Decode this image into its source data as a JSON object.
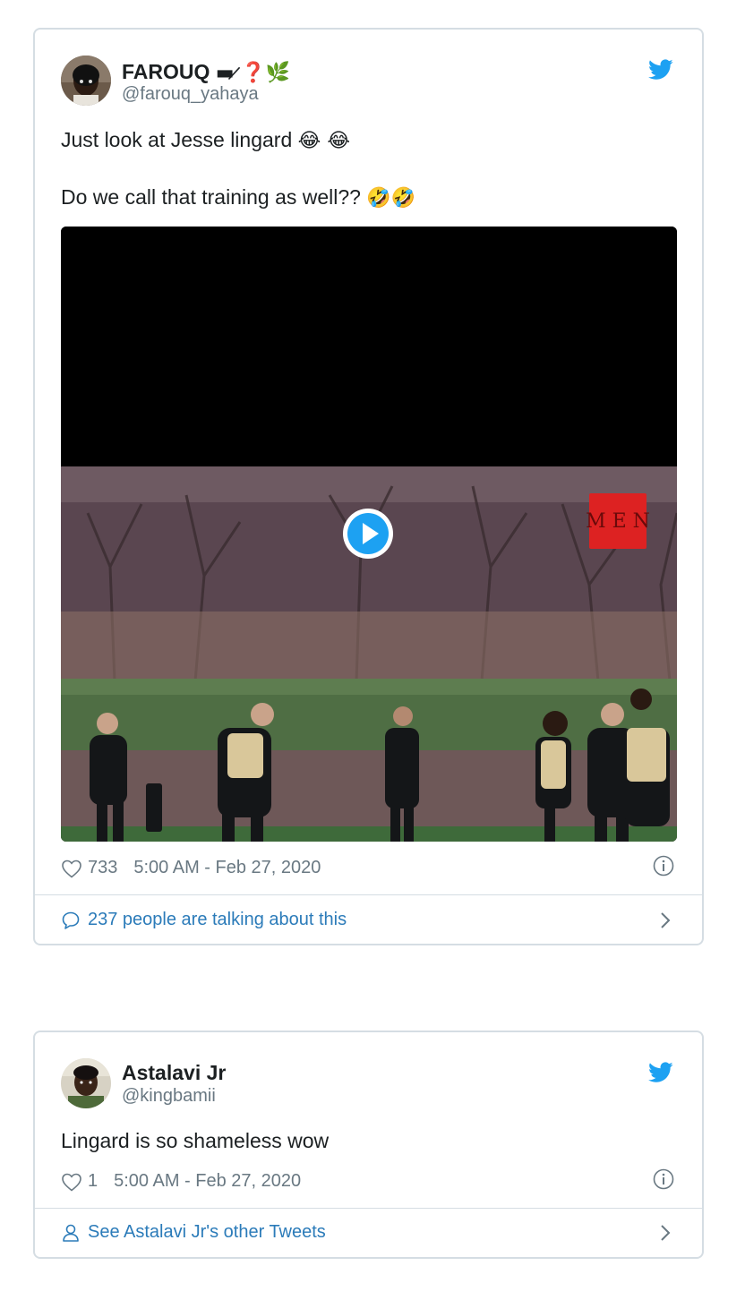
{
  "tweets": [
    {
      "author_name": "FAROUQ",
      "author_name_emoji": "▬ ̷❓🌿",
      "handle": "@farouq_yahaya",
      "text_line1": "Just look at Jesse lingard",
      "text_line1_emoji": "😂 😂",
      "text_line2": "Do we call that training as well??",
      "text_line2_emoji": "🤣🤣",
      "media": {
        "type": "video",
        "watermark": "M E N"
      },
      "likes": "733",
      "timestamp": "5:00 AM - Feb 27, 2020",
      "footer_link": "237 people are talking about this",
      "footer_icon": "comment-icon"
    },
    {
      "author_name": "Astalavi Jr",
      "handle": "@kingbamii",
      "text_line1": "Lingard is so shameless wow",
      "likes": "1",
      "timestamp": "5:00 AM - Feb 27, 2020",
      "footer_link": "See Astalavi Jr's other Tweets",
      "footer_icon": "person-icon"
    }
  ],
  "colors": {
    "link": "#2b7bb9",
    "twitter_blue": "#1da1f2",
    "muted": "#697882",
    "border": "#d5dde3"
  }
}
